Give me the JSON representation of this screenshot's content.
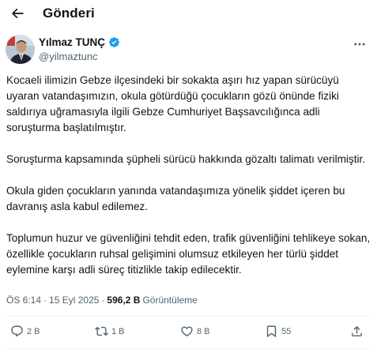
{
  "header": {
    "title": "Gönderi"
  },
  "author": {
    "display_name": "Yılmaz TUNÇ",
    "handle": "@yilmaztunc",
    "verified": true
  },
  "tweet": {
    "paragraphs": [
      "Kocaeli ilimizin Gebze ilçesindeki bir sokakta aşırı hız yapan sürücüyü uyaran vatandaşımızın, okula götürdüğü çocukların gözü önünde fiziki saldırıya uğramasıyla ilgili Gebze Cumhuriyet Başsavcılığınca adli soruşturma başlatılmıştır.",
      "Soruşturma kapsamında şüpheli sürücü hakkında gözaltı talimatı verilmiştir.",
      "Okula giden çocukların yanında vatandaşımıza yönelik şiddet içeren bu davranış asla kabul edilemez.",
      "Toplumun huzur ve güvenliğini tehdit eden, trafik güvenliğini tehlikeye sokan, özellikle çocukların ruhsal gelişimini olumsuz etkileyen her türlü şiddet eylemine karşı adli süreç titizlikle takip edilecektir."
    ]
  },
  "meta": {
    "time": "ÖS 6:14",
    "separator": "·",
    "date": "15 Eyl 2025",
    "views_count": "596,2 B",
    "views_label": "Görüntüleme"
  },
  "actions": {
    "reply": {
      "icon": "reply-icon",
      "count": "2 B"
    },
    "repost": {
      "icon": "repost-icon",
      "count": "1 B"
    },
    "like": {
      "icon": "like-icon",
      "count": "8 B"
    },
    "bookmark": {
      "icon": "bookmark-icon",
      "count": "55"
    },
    "share": {
      "icon": "share-icon"
    }
  },
  "colors": {
    "text": "#0f1419",
    "secondary": "#536471",
    "verified": "#1d9bf0",
    "divider": "#eff3f4"
  }
}
